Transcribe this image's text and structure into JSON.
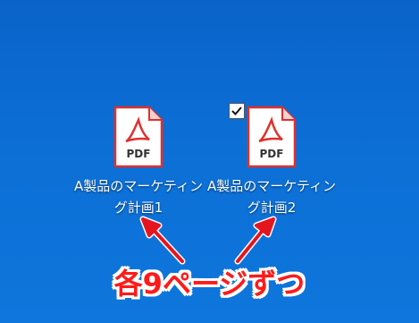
{
  "desktop": {
    "icons": [
      {
        "label": "A製品のマーケティン\nグ計画1",
        "icon": "pdf-file-icon",
        "badge": "PDF",
        "selected": false
      },
      {
        "label": "A製品のマーケティン\nグ計画2",
        "icon": "pdf-file-icon",
        "badge": "PDF",
        "selected": true
      }
    ]
  },
  "annotation": {
    "text": "各9ページずつ",
    "color": "#e5151f"
  },
  "colors": {
    "desktop_background": "#0c6fd6",
    "pdf_red": "#e0302c"
  }
}
